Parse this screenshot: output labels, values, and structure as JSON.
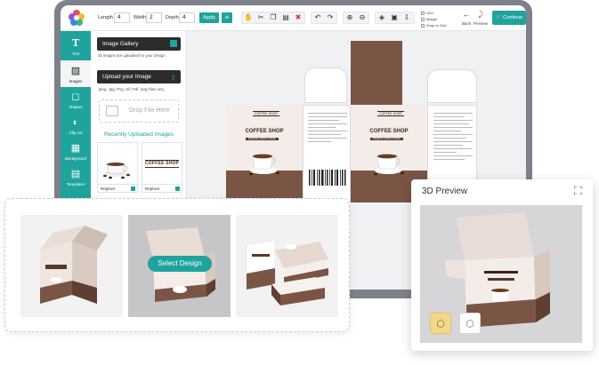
{
  "toolbar": {
    "length_label": "Length",
    "length_value": "4",
    "width_label": "Width",
    "width_value": "2",
    "depth_label": "Depth",
    "depth_value": "4",
    "apply_label": "Apply",
    "grid_label": "Grid",
    "margin_label": "Margin",
    "snap_label": "Snap to Grid",
    "back_label": "Back",
    "preview_label": "Preview",
    "continue_label": "Continue"
  },
  "sidebar": {
    "items": [
      {
        "label": "Text",
        "icon": "text-icon"
      },
      {
        "label": "Images",
        "icon": "image-icon"
      },
      {
        "label": "Shapes",
        "icon": "shapes-icon"
      },
      {
        "label": "Clip Art",
        "icon": "clipart-icon"
      },
      {
        "label": "Background",
        "icon": "background-icon"
      },
      {
        "label": "Templates",
        "icon": "templates-icon"
      }
    ],
    "active": "Images"
  },
  "panel": {
    "gallery_label": "Image Gallery",
    "gallery_note": "25 images are uploaded for your design",
    "upload_label": "Upload your Image",
    "upload_note": "Jpeg, Jpg, Png, Gif, Pdf, Svg Files only",
    "drop_label": "Drop File Here",
    "recent_title": "Recently Uploaded Images",
    "thumb_1_action": "Replace",
    "thumb_2_action": "Replace",
    "thumb_2_word": "COFFEE SHOP"
  },
  "canvas": {
    "brand_badge": "COFFEE SHOP",
    "brand_name": "COFFEE SHOP",
    "brand_strap": "PREMIUM GRADE COFFEE"
  },
  "chooser": {
    "select_label": "Select Design"
  },
  "preview": {
    "title": "3D Preview"
  },
  "colors": {
    "accent": "#1fa39d",
    "box_brown": "#7a5545",
    "box_cream": "#f3ece8",
    "dark_button": "#2c2c2c",
    "mode_active": "#f4d98c"
  }
}
